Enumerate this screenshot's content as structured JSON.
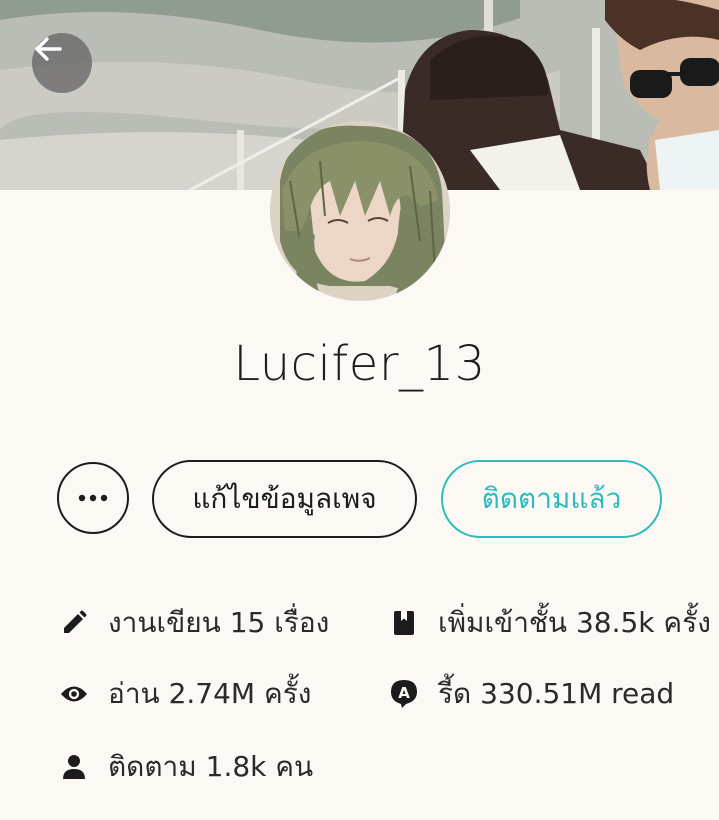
{
  "header": {
    "back_icon": "arrow-left-icon",
    "cover_alt": "cover photo"
  },
  "profile": {
    "username": "Lucifer_13",
    "avatar_icon": "avatar"
  },
  "actions": {
    "more_icon": "ellipsis-icon",
    "edit_label": "แก้ไขข้อมูลเพจ",
    "follow_label": "ติดตามแล้ว",
    "accent_color": "#2bbcc0"
  },
  "stats": {
    "works": {
      "icon": "pencil-icon",
      "text": "งานเขียน 15 เรื่อง"
    },
    "shelf": {
      "icon": "book-icon",
      "text": "เพิ่มเข้าชั้น 38.5k ครั้ง"
    },
    "reads": {
      "icon": "eye-icon",
      "text": "อ่าน 2.74M ครั้ง"
    },
    "read_count": {
      "icon": "read-badge-icon",
      "text": "รี้ด 330.51M read"
    },
    "followers": {
      "icon": "person-icon",
      "text": "ติดตาม 1.8k คน"
    }
  }
}
